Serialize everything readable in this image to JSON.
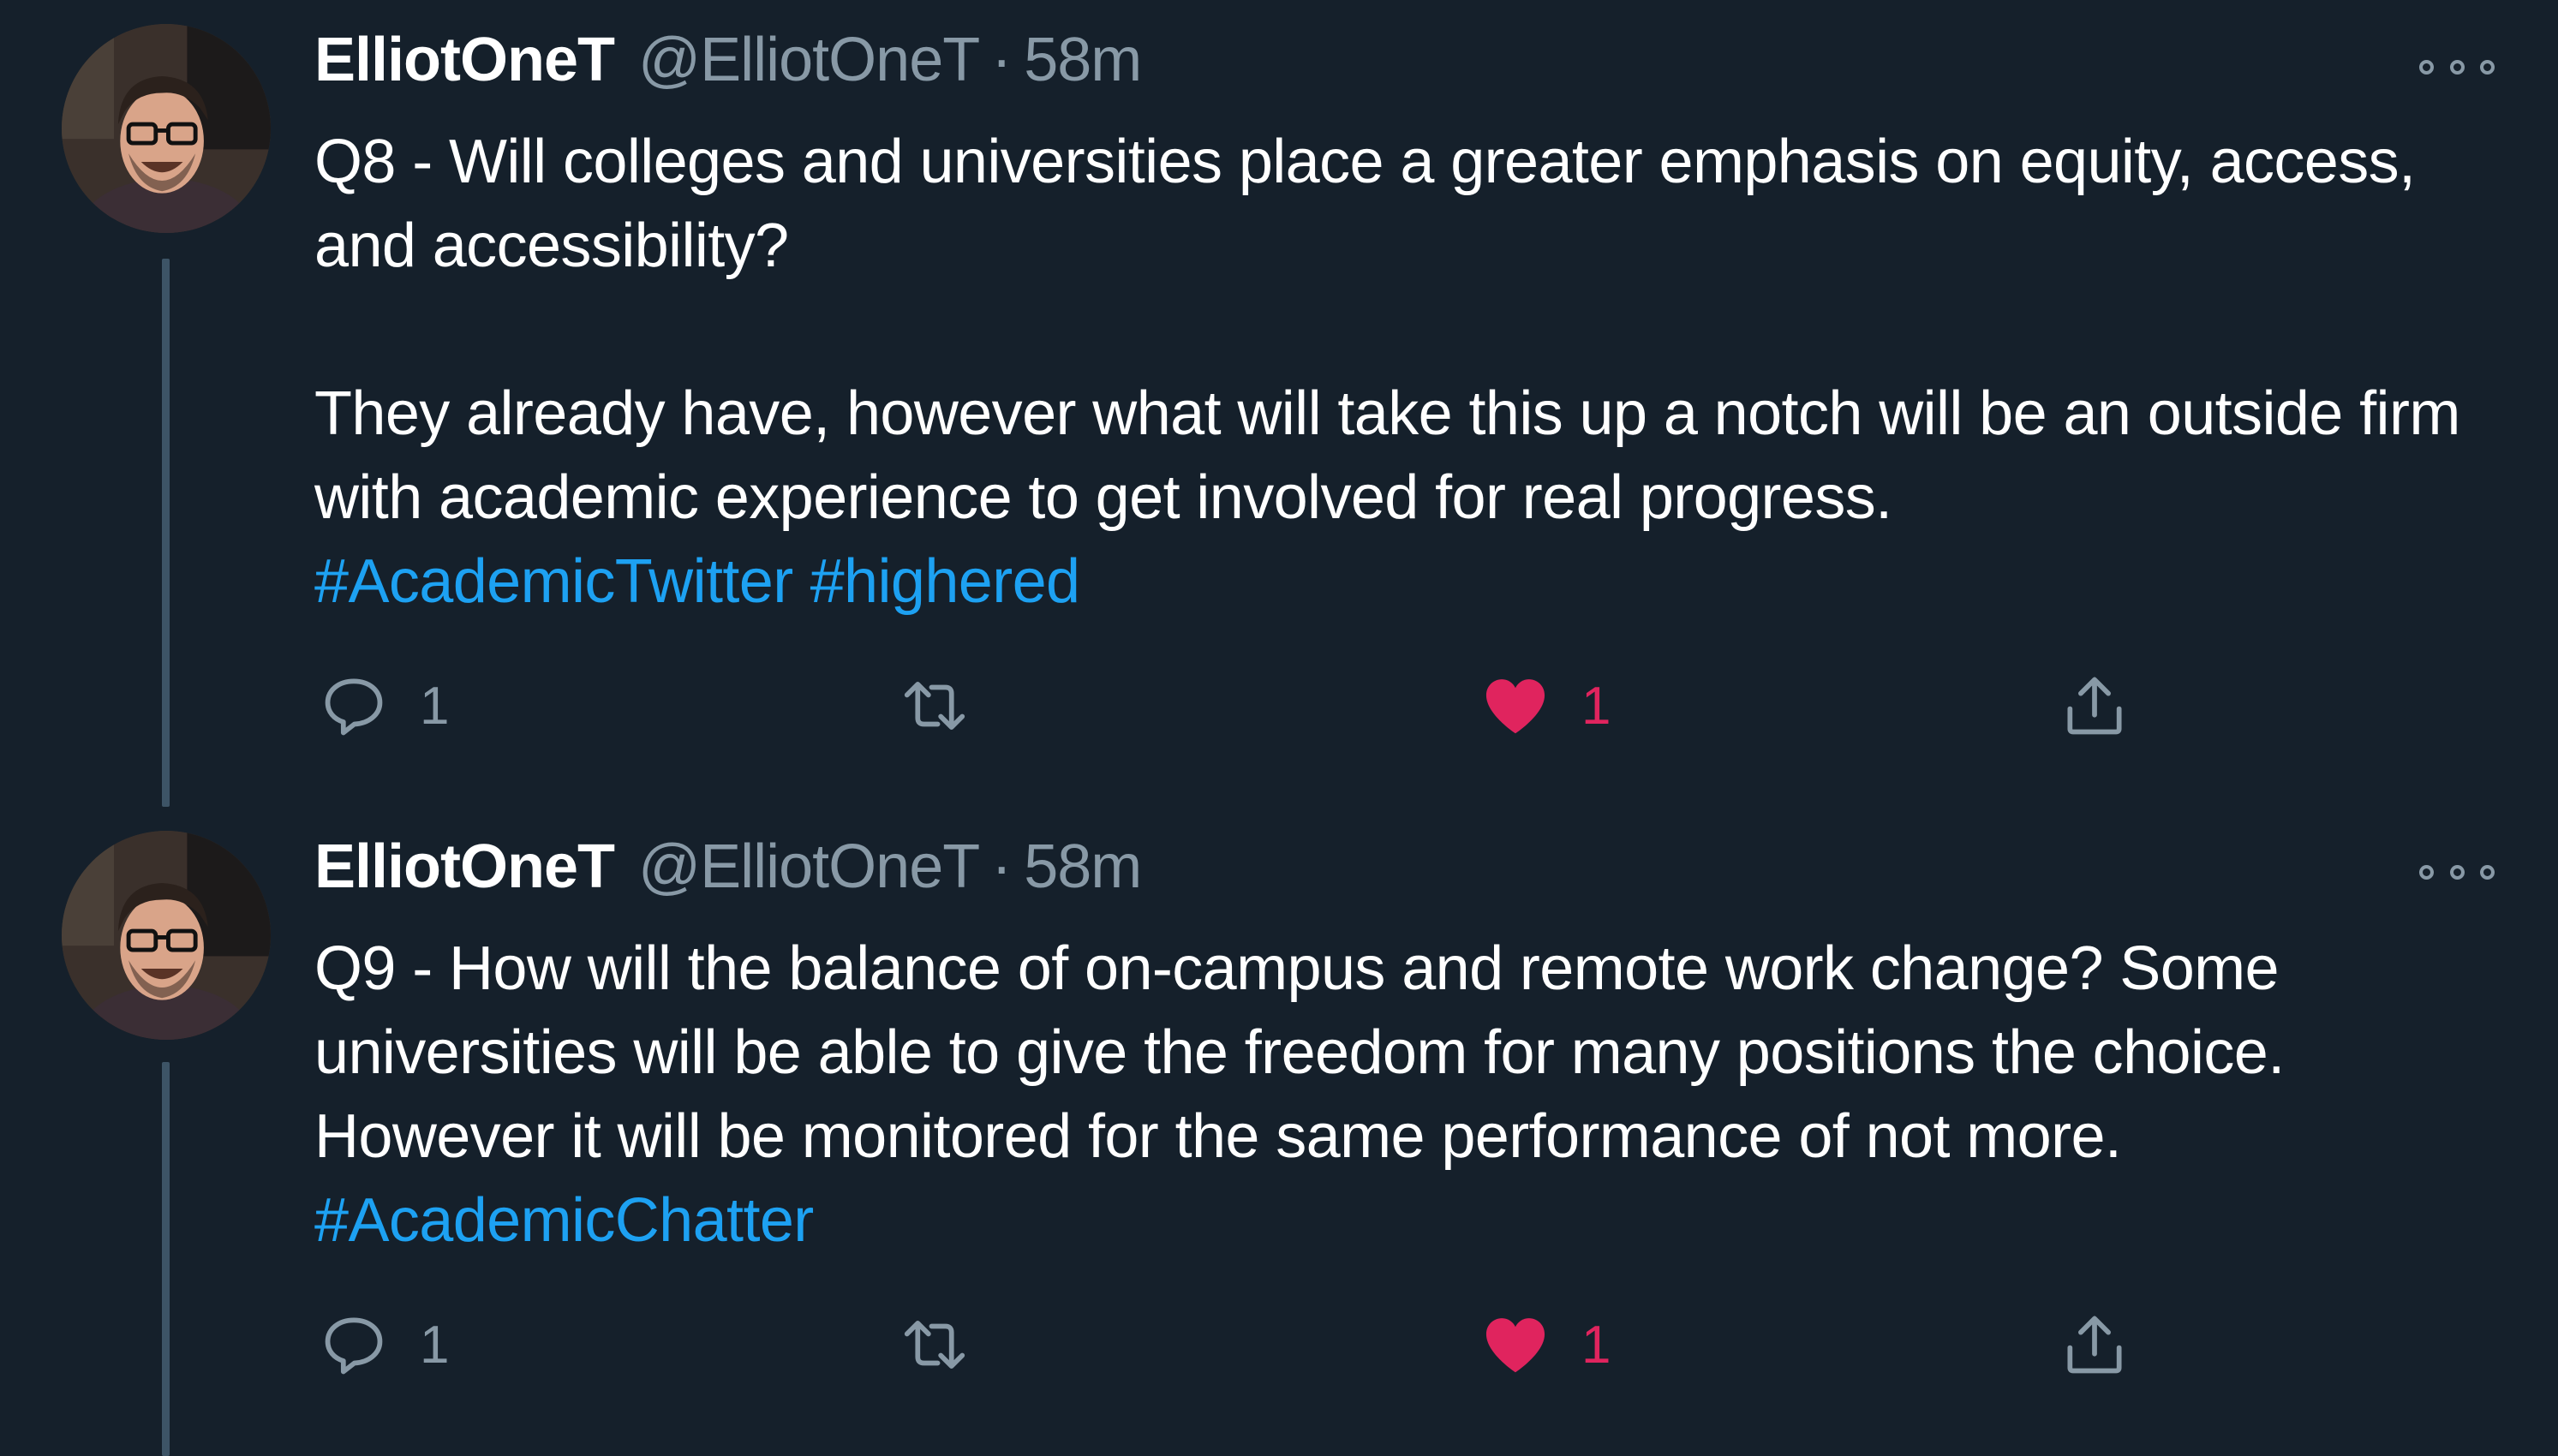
{
  "tweets": [
    {
      "author_name": "ElliotOneT",
      "author_handle": "@ElliotOneT",
      "separator": "·",
      "time": "58m",
      "paragraphs": [
        "Q8 - Will colleges and universities place a greater emphasis on equity, access, and accessibility?",
        "They already have, however what will take this up a notch will be an outside firm with academic experience to get involved for real progress."
      ],
      "hashtags": [
        "#AcademicTwitter",
        "#highered"
      ],
      "reply_count": "1",
      "retweet_count": "",
      "like_count": "1",
      "liked": true
    },
    {
      "author_name": "ElliotOneT",
      "author_handle": "@ElliotOneT",
      "separator": "·",
      "time": "58m",
      "paragraphs": [
        "Q9 - How will the balance of on-campus and remote work change? Some universities will be able to give the freedom for many positions the choice. However it will be monitored for the same performance of not more."
      ],
      "hashtags": [
        "#AcademicChatter"
      ],
      "reply_count": "1",
      "retweet_count": "",
      "like_count": "1",
      "liked": true
    }
  ],
  "icons": {
    "more": "more-horizontal-icon",
    "reply": "speech-bubble-icon",
    "retweet": "retweet-arrows-icon",
    "like": "heart-icon",
    "share": "share-upload-icon"
  },
  "colors": {
    "background": "#15202b",
    "text": "#ffffff",
    "muted": "#8899a6",
    "link": "#1da1f2",
    "like": "#e0245e",
    "thread_line": "#3d5466"
  }
}
